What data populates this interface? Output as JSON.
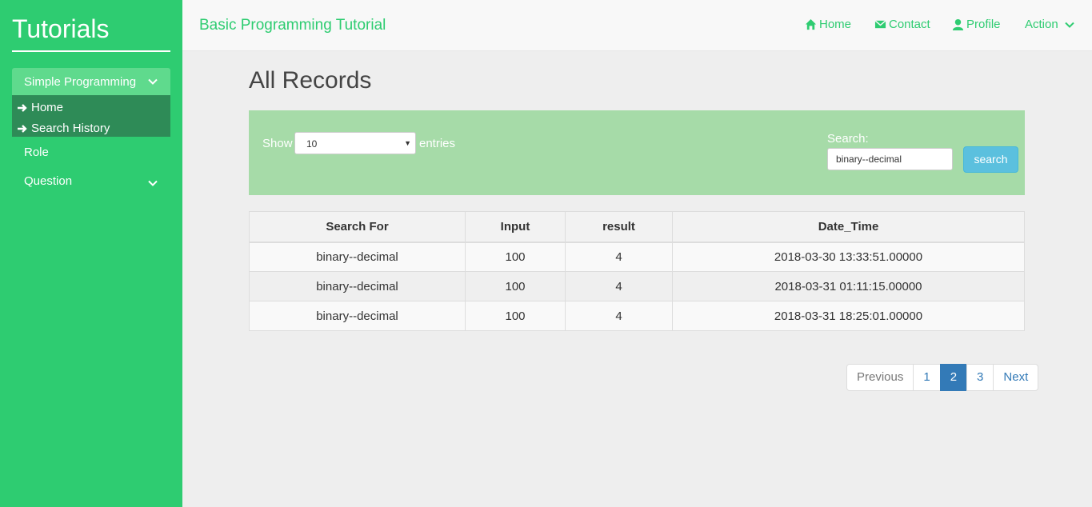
{
  "sidebar": {
    "brand": "Tutorials",
    "menu_parent": "Simple Programming",
    "submenu": [
      "Home",
      "Search History"
    ],
    "role": "Role",
    "question": "Question"
  },
  "topbar": {
    "title": "Basic Programming Tutorial",
    "nav": {
      "home": "Home",
      "contact": "Contact",
      "profile": "Profile",
      "action": "Action"
    }
  },
  "main": {
    "page_title": "All Records",
    "filter": {
      "show_label": "Show",
      "entries_value": "10",
      "entries_label": "entries",
      "search_label": "Search:",
      "search_value": "binary--decimal",
      "search_button": "search"
    },
    "table": {
      "headers": [
        "Search For",
        "Input",
        "result",
        "Date_Time"
      ],
      "rows": [
        [
          "binary--decimal",
          "100",
          "4",
          "2018-03-30 13:33:51.00000"
        ],
        [
          "binary--decimal",
          "100",
          "4",
          "2018-03-31 01:11:15.00000"
        ],
        [
          "binary--decimal",
          "100",
          "4",
          "2018-03-31 18:25:01.00000"
        ]
      ]
    },
    "pagination": {
      "previous": "Previous",
      "pages": [
        "1",
        "2",
        "3"
      ],
      "active_page": "2",
      "next": "Next"
    }
  },
  "colors": {
    "sidebar_bg": "#2ecc71",
    "submenu_bg": "#2e8b57",
    "panel_bg": "#a6dba8",
    "search_button": "#5bc0de",
    "active_page": "#337ab7"
  }
}
